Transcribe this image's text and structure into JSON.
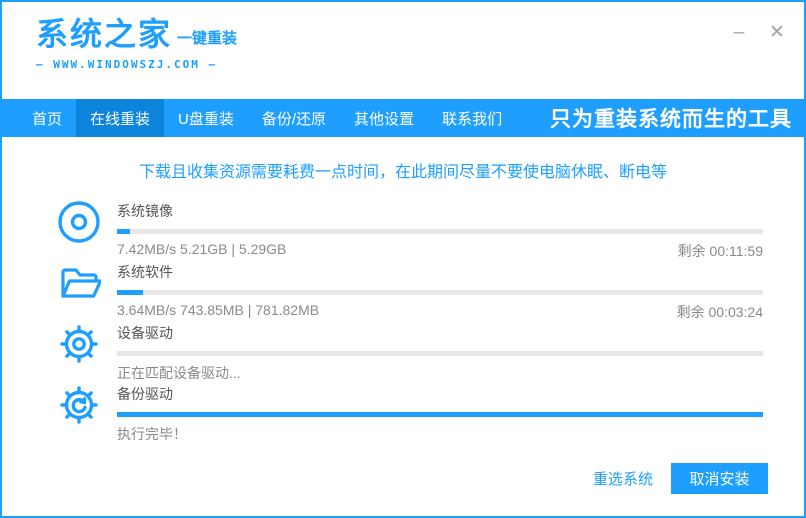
{
  "window": {
    "controls": {
      "minimize": "–",
      "close": "✕"
    }
  },
  "header": {
    "logo_text": "系统之家",
    "logo_suffix": "一键重装",
    "website": "—  WWW.WINDOWSZJ.COM  —"
  },
  "nav": {
    "items": [
      {
        "label": "首页",
        "active": false
      },
      {
        "label": "在线重装",
        "active": true
      },
      {
        "label": "U盘重装",
        "active": false
      },
      {
        "label": "备份/还原",
        "active": false
      },
      {
        "label": "其他设置",
        "active": false
      },
      {
        "label": "联系我们",
        "active": false
      }
    ],
    "slogan": "只为重装系统而生的工具"
  },
  "notice": "下载且收集资源需要耗费一点时间，在此期间尽量不要使电脑休眠、断电等",
  "tasks": [
    {
      "icon": "disc-icon",
      "title": "系统镜像",
      "progress_percent": 2,
      "status": "7.42MB/s 5.21GB | 5.29GB",
      "remaining": "剩余 00:11:59"
    },
    {
      "icon": "folder-icon",
      "title": "系统软件",
      "progress_percent": 4,
      "status": "3.64MB/s 743.85MB | 781.82MB",
      "remaining": "剩余 00:03:24"
    },
    {
      "icon": "gear-icon",
      "title": "设备驱动",
      "progress_percent": 0,
      "status": "正在匹配设备驱动...",
      "remaining": ""
    },
    {
      "icon": "gear-sync-icon",
      "title": "备份驱动",
      "progress_percent": 100,
      "status": "执行完毕！",
      "remaining": ""
    }
  ],
  "footer": {
    "reselect_label": "重选系统",
    "cancel_label": "取消安装"
  },
  "colors": {
    "accent": "#1E9FFF",
    "nav_active": "#0D84DB",
    "track": "#E8E8E8"
  }
}
